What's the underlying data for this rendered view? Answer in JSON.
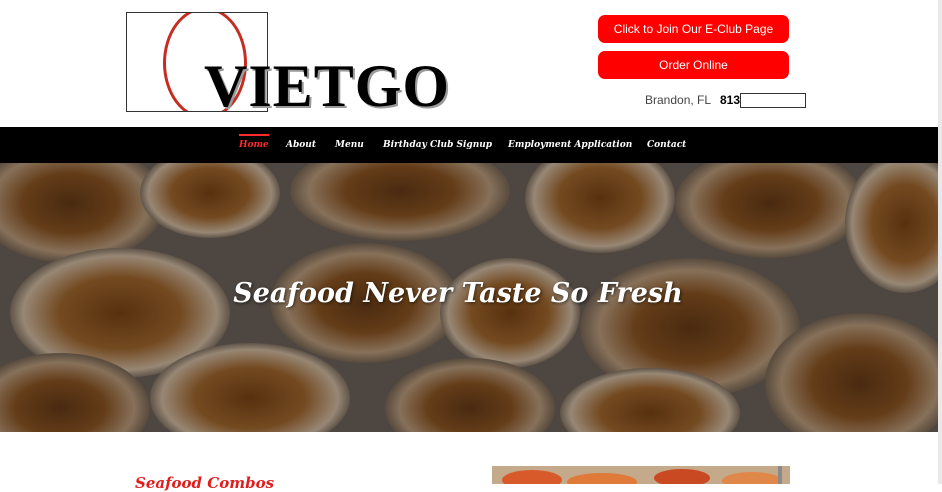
{
  "header": {
    "logo_text": "VIETGO",
    "eclub_button": "Click to Join Our E-Club Page",
    "order_button": "Order Online",
    "location": "Brandon, FL",
    "phone": "813"
  },
  "nav": {
    "items": [
      "Home",
      "About",
      "Menu",
      "Birthday Club Signup",
      "Employment Application",
      "Contact"
    ],
    "active_index": 0
  },
  "hero": {
    "title": "Seafood Never Taste So Fresh"
  },
  "section": {
    "heading": "Seafood Combos"
  },
  "colors": {
    "accent_red": "#ff0000",
    "nav_bg": "#000000",
    "heading_red": "#e01e1e"
  }
}
